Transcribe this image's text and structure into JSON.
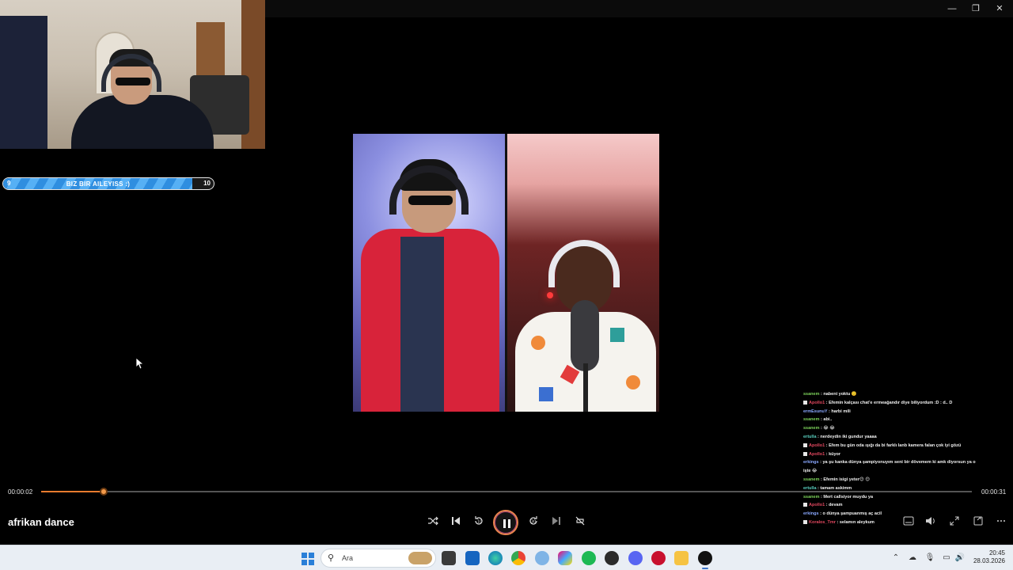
{
  "window": {
    "minimize_glyph": "—",
    "maximize_glyph": "❐",
    "close_glyph": "✕"
  },
  "goal": {
    "start": "9",
    "label": "BIZ BIR AILEYISS :)",
    "end": "10",
    "progress_fraction": 0.9
  },
  "chat": [
    {
      "badge": false,
      "user": "ssanem",
      "color": "green",
      "text": "nabeni yoktu 🙂"
    },
    {
      "badge": true,
      "user": "Apollo1",
      "color": "red",
      "text": "Efemin kalçası chat'e ermeağandır diye biliyordum :D : d.. D"
    },
    {
      "badge": false,
      "user": "ermEsunuY",
      "color": "blue",
      "text": "harbi mili"
    },
    {
      "badge": false,
      "user": "ssanem",
      "color": "green",
      "text": "abi.."
    },
    {
      "badge": false,
      "user": "ssanem",
      "color": "green",
      "text": "😂 😂"
    },
    {
      "badge": false,
      "user": "ertulla",
      "color": "teal",
      "text": "nerdeydin iki gundur yaaaa"
    },
    {
      "badge": true,
      "user": "Apollo1",
      "color": "red",
      "text": "Efem bu gün oda ışığı da bi farklı lanb kamera falan çok iyi gözü"
    },
    {
      "badge": true,
      "user": "Apollo1",
      "color": "red",
      "text": "küyor"
    },
    {
      "badge": false,
      "user": "erkings",
      "color": "blue",
      "text": "ya şu kanka dünya şampiyonuyım seni bir dövemem ki amk diyorsun ya o"
    },
    {
      "badge": false,
      "user": "",
      "color": "blue",
      "text": "işte 😂"
    },
    {
      "badge": false,
      "user": "ssanem",
      "color": "green",
      "text": "Efemin isigi yeter😊 😊"
    },
    {
      "badge": false,
      "user": "ertulla",
      "color": "teal",
      "text": "tamam askimm"
    },
    {
      "badge": false,
      "user": "ssanem",
      "color": "green",
      "text": "Mert callsiyor muydu ya"
    },
    {
      "badge": true,
      "user": "Apollo1",
      "color": "red",
      "text": "devam"
    },
    {
      "badge": false,
      "user": "erkings",
      "color": "blue",
      "text": "o dünya şampuanmış aç acil"
    },
    {
      "badge": true,
      "user": "Koralos_Tmr",
      "color": "red",
      "text": "selamın aleykum"
    }
  ],
  "player": {
    "current_time": "00:00:02",
    "total_time": "00:00:31",
    "progress_fraction": 0.067,
    "title": "afrikan dance"
  },
  "taskbar": {
    "search_placeholder": "Ara",
    "time": "20:45",
    "date": "28.03.2026"
  },
  "colors": {
    "accent": "#e87b2e",
    "goal_fill": "#2f8ee0"
  }
}
